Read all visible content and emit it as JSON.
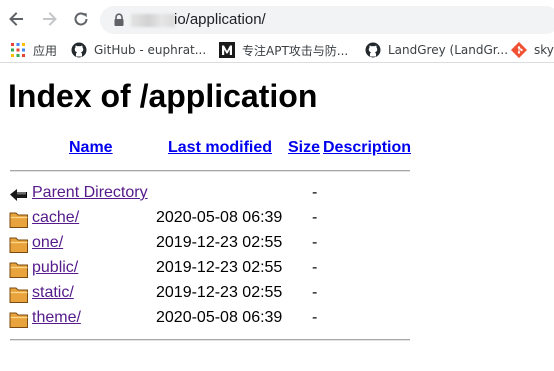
{
  "browser": {
    "url_suffix": "io/application/",
    "bookmarks": [
      {
        "label": "应用",
        "icon": "apps-grid-icon"
      },
      {
        "label": "GitHub - euphrat...",
        "icon": "github-icon"
      },
      {
        "label": "专注APT攻击与防...",
        "icon": "m-logo-icon"
      },
      {
        "label": "LandGrey (LandGr...",
        "icon": "github-icon"
      },
      {
        "label": "sky",
        "icon": "git-diamond-icon"
      }
    ]
  },
  "page": {
    "title": "Index of /application",
    "columns": {
      "name": "Name",
      "last_modified": "Last modified",
      "size": "Size",
      "description": "Description"
    },
    "parent": {
      "name": "Parent Directory",
      "size": "-",
      "icon": "back-arrow-icon"
    },
    "entries": [
      {
        "name": "cache/",
        "modified": "2020-05-08 06:39",
        "size": "-",
        "icon": "folder-icon"
      },
      {
        "name": "one/",
        "modified": "2019-12-23 02:55",
        "size": "-",
        "icon": "folder-icon"
      },
      {
        "name": "public/",
        "modified": "2019-12-23 02:55",
        "size": "-",
        "icon": "folder-icon"
      },
      {
        "name": "static/",
        "modified": "2019-12-23 02:55",
        "size": "-",
        "icon": "folder-icon"
      },
      {
        "name": "theme/",
        "modified": "2020-05-08 06:39",
        "size": "-",
        "icon": "folder-icon"
      }
    ]
  },
  "colors": {
    "link": "#0000ee",
    "visited_link": "#551a8b",
    "omnibox_bg": "#f1f3f4"
  }
}
